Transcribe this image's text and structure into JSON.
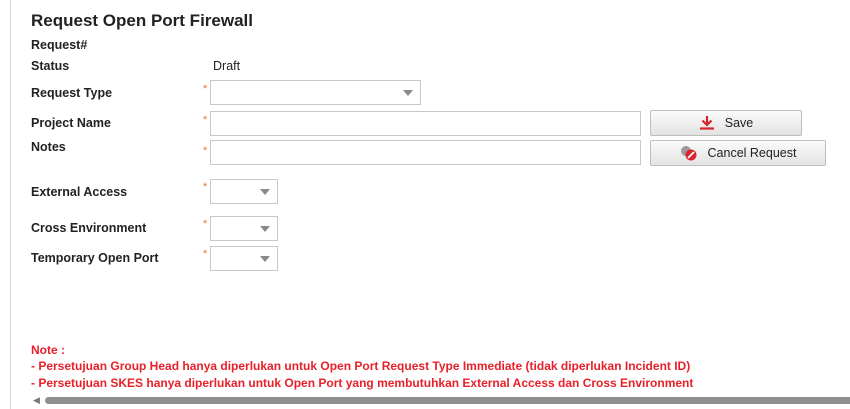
{
  "page": {
    "title": "Request Open Port Firewall"
  },
  "form": {
    "request_no_label": "Request#",
    "status_label": "Status",
    "status_value": "Draft",
    "request_type_label": "Request Type",
    "project_name_label": "Project Name",
    "notes_label": "Notes",
    "external_access_label": "External Access",
    "cross_environment_label": "Cross Environment",
    "temporary_open_port_label": "Temporary Open Port",
    "required_marker": "*",
    "request_type_value": "",
    "project_name_value": "",
    "notes_value": "",
    "external_access_value": "",
    "cross_environment_value": "",
    "temporary_open_port_value": ""
  },
  "buttons": {
    "save_label": "Save",
    "cancel_label": "Cancel Request"
  },
  "notes": {
    "heading": "Note :",
    "line1": "- Persetujuan Group Head hanya diperlukan untuk Open Port Request Type Immediate (tidak diperlukan Incident ID)",
    "line2": "- Persetujuan SKES hanya diperlukan untuk Open Port yang membutuhkan External Access dan Cross Environment"
  },
  "colors": {
    "required": "#e8772e",
    "note_text": "#e8202a",
    "save_icon": "#d9232d"
  },
  "icons": {
    "save": "download-icon",
    "cancel": "cancel-icon",
    "dropdown": "chevron-down-icon"
  }
}
